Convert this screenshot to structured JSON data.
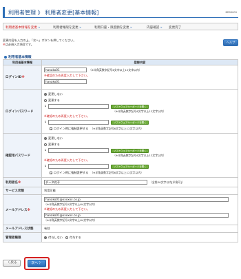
{
  "header": {
    "title": "利用者管理 》 利用者変更[基本情報]",
    "screen_code": "BRSK009"
  },
  "steps": [
    {
      "label": "利用者基本情報を変更",
      "active": true
    },
    {
      "label": "利用者権限を変更",
      "active": false
    },
    {
      "label": "利用口座・限度額を変更",
      "active": false
    },
    {
      "label": "内容確認",
      "active": false
    },
    {
      "label": "変更完了",
      "active": false
    }
  ],
  "intro": {
    "line1": "変更内容を入力の上、「次へ」ボタンを押してください。",
    "line2_mark": "※",
    "line2": "は必須入力項目です。"
  },
  "help_label": "ヘルプ",
  "section_title": "利用者基本情報",
  "table": {
    "col_item": "利用者基本情報",
    "col_input": "登録内容",
    "login_id": {
      "label": "ログインID",
      "req": "※",
      "value": "hanako01",
      "note": "（※半角英数字記号6文字以上12文字以内）",
      "warn": "※確認のため再度入力して下さい。",
      "confirm_value": "hanako01"
    },
    "login_pw": {
      "label": "ログインパスワード",
      "opt_nochange": "変更しない",
      "opt_change": "変更する",
      "keyboard_label": "ソフトウェアキーボードを開く",
      "note": "（※半角英数字記号6文字以上12文字以内）",
      "warn": "※確認のため再度入力して下さい。",
      "force_change": "ログイン時に強制変更する"
    },
    "confirm_pw": {
      "label": "確認用パスワード",
      "opt_nochange": "変更しない",
      "opt_change": "変更する",
      "keyboard_label": "ソフトウェアキーボードを開く",
      "note": "（※半角英数字記号6文字以上12文字以内）",
      "warn": "※確認のため再度入力して下さい。",
      "force_change": "ログイン時に強制変更する"
    },
    "user_name": {
      "label": "利用者名",
      "req": "※",
      "value": "データ花子",
      "note": "（全角30文字以内[半角可]）"
    },
    "service_status": {
      "label": "サービス状態",
      "value": "利用可能"
    },
    "email": {
      "label": "メールアドレス",
      "req": "※",
      "value": "hanako01@xxxxxx.co.jp",
      "note": "（※半角英数字記号4文字以上64文字以内）",
      "warn": "※確認のため再度入力して下さい。",
      "confirm_value": "hanako01@xxxxxx.co.jp",
      "confirm_note": "（※半角英数字記号4文字以上64文字以内）"
    },
    "email_status": {
      "label": "メールアドレス状態",
      "value": "有効"
    },
    "admin": {
      "label": "管理者権限",
      "opt_no": "付与しない",
      "opt_yes": "付与する"
    }
  },
  "footer": {
    "back_label": "〈 戻る",
    "next_label": "次へ 〉"
  }
}
